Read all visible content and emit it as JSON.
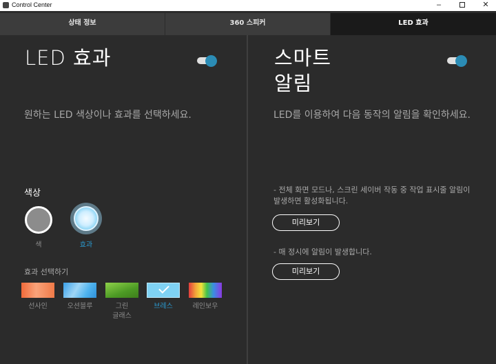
{
  "window": {
    "title": "Control Center"
  },
  "tabs": [
    {
      "label": "상태 정보"
    },
    {
      "label": "360 스피커"
    },
    {
      "label": "LED 효과"
    }
  ],
  "led": {
    "title": "LED 효과",
    "description": "원하는 LED 색상이나 효과를 선택하세요.",
    "toggle_on": true,
    "color_label": "색상",
    "color_option": "색",
    "effect_option": "효과",
    "effects_heading": "효과 선택하기",
    "effects": [
      {
        "label": "선사인",
        "selected": false
      },
      {
        "label": "오션블루",
        "selected": false
      },
      {
        "label": "그린\n글래스",
        "selected": false
      },
      {
        "label": "브레스",
        "selected": true
      },
      {
        "label": "레인보우",
        "selected": false
      }
    ]
  },
  "smart": {
    "title_line1": "스마트",
    "title_line2": "알림",
    "toggle_on": true,
    "description": "LED를 이용하여 다음 동작의 알림을 확인하세요.",
    "item1_text": "- 전체 화면 모드나, 스크린 세이버 작동 중 작업 표시줄 알림이 발생하면 활성화됩니다.",
    "item1_button": "미리보기",
    "item2_text": "- 매 정시에 알림이 발생합니다.",
    "item2_button": "미리보기"
  },
  "colors": {
    "accent": "#2b8cb5",
    "background": "#2b2b2b",
    "active_tab": "#1a1a1a"
  }
}
